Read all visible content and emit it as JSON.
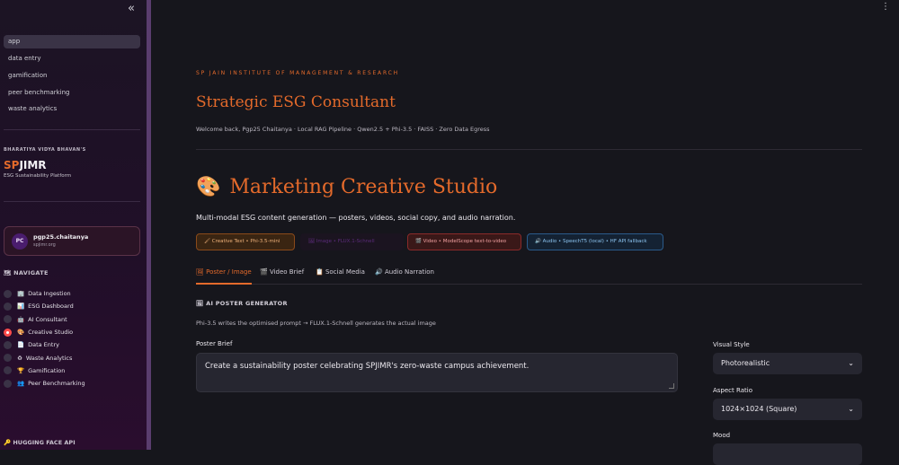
{
  "sidebar": {
    "collapse_label": "«",
    "pages": [
      "app",
      "data entry",
      "gamification",
      "peer benchmarking",
      "waste analytics"
    ],
    "brand_kicker": "BHARATIYA VIDYA BHAVAN'S",
    "brand_accent": "SP",
    "brand_rest": "JIMR",
    "brand_sub": "ESG Sustainability Platform",
    "user": {
      "initials": "PC",
      "name": "pgp25.chaitanya",
      "domain": "spjimr.org"
    },
    "nav_heading": "🗺 NAVIGATE",
    "nav_items": [
      {
        "icon": "🏢",
        "label": "Data Ingestion"
      },
      {
        "icon": "📊",
        "label": "ESG Dashboard"
      },
      {
        "icon": "🤖",
        "label": "AI Consultant"
      },
      {
        "icon": "🎨",
        "label": "Creative Studio"
      },
      {
        "icon": "📄",
        "label": "Data Entry"
      },
      {
        "icon": "♻",
        "label": "Waste Analytics"
      },
      {
        "icon": "🏆",
        "label": "Gamification"
      },
      {
        "icon": "👥",
        "label": "Peer Benchmarking"
      }
    ],
    "selected_nav_index": 3,
    "hf_heading": "🔑 HUGGING FACE API"
  },
  "header": {
    "menu_icon": "⋮",
    "eyebrow": "SP JAIN INSTITUTE OF MANAGEMENT & RESEARCH",
    "title": "Strategic ESG Consultant",
    "welcome": "Welcome back, Pgp25 Chaitanya · Local RAG Pipeline · Qwen2.5 + Phi-3.5 · FAISS · Zero Data Egress"
  },
  "studio": {
    "icon": "🎨",
    "title": "Marketing Creative Studio",
    "subtitle": "Multi-modal ESG content generation — posters, videos, social copy, and audio narration.",
    "pills": [
      "🖌 Creative Text • Phi-3.5-mini",
      "🖼 Image • FLUX.1-Schnell",
      "🎬 Video • ModelScope text-to-video",
      "🔊 Audio • SpeechT5 (local) • HF API fallback"
    ],
    "tabs": [
      "🖼 Poster / Image",
      "🎬 Video Brief",
      "📋 Social Media",
      "🔊 Audio Narration"
    ],
    "active_tab": 0
  },
  "poster": {
    "section_heading": "🖼 AI POSTER GENERATOR",
    "section_note": "Phi-3.5 writes the optimised prompt → FLUX.1-Schnell generates the actual image",
    "brief_label": "Poster Brief",
    "brief_value": "Create a sustainability poster celebrating SPJIMR's zero-waste campus achievement.",
    "visual_style_label": "Visual Style",
    "visual_style_value": "Photorealistic",
    "aspect_ratio_label": "Aspect Ratio",
    "aspect_ratio_value": "1024×1024 (Square)",
    "mood_label": "Mood"
  },
  "colors": {
    "accent": "#e46a2b",
    "sidebar_bg": "#200f28",
    "main_bg": "#16161c"
  }
}
